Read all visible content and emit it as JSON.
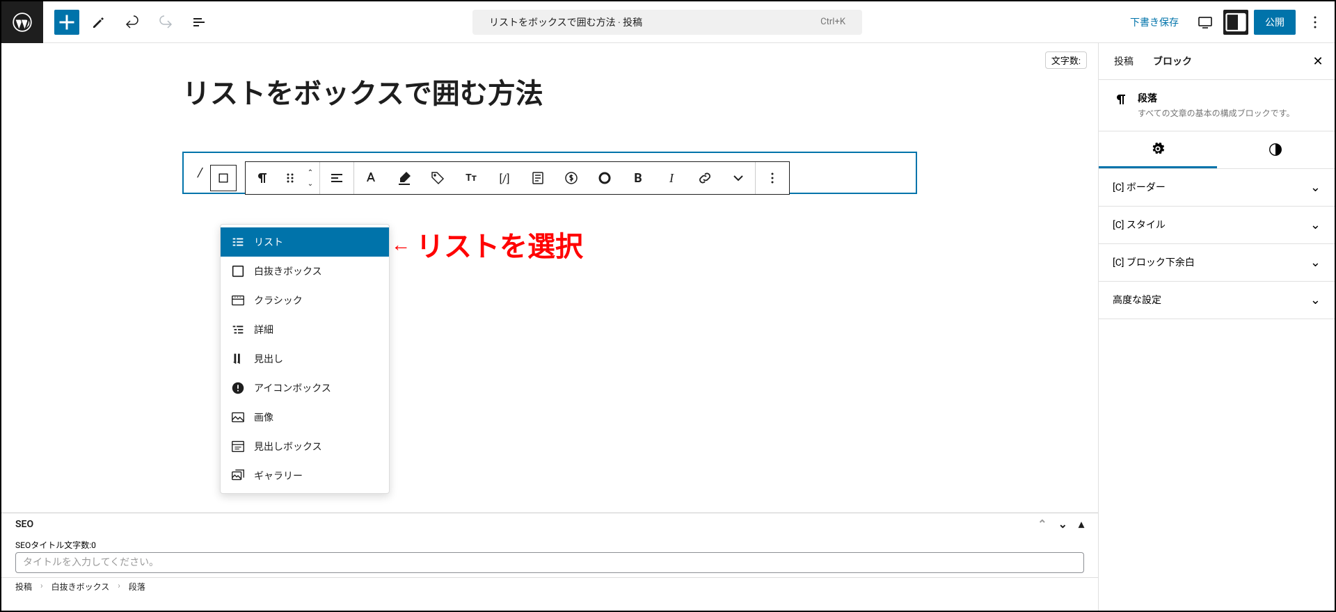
{
  "header": {
    "doc_title": "リストをボックスで囲む方法 · 投稿",
    "shortcut": "Ctrl+K",
    "save_draft": "下書き保存",
    "publish": "公開"
  },
  "editor": {
    "word_count_label": "文字数:",
    "post_title": "リストをボックスで囲む方法",
    "para_content": "/",
    "annotation": "リストを選択"
  },
  "dropdown": {
    "items": [
      {
        "label": "リスト",
        "icon": "list"
      },
      {
        "label": "白抜きボックス",
        "icon": "box"
      },
      {
        "label": "クラシック",
        "icon": "classic"
      },
      {
        "label": "詳細",
        "icon": "details"
      },
      {
        "label": "見出し",
        "icon": "heading"
      },
      {
        "label": "アイコンボックス",
        "icon": "iconbox"
      },
      {
        "label": "画像",
        "icon": "image"
      },
      {
        "label": "見出しボックス",
        "icon": "headingbox"
      },
      {
        "label": "ギャラリー",
        "icon": "gallery"
      }
    ]
  },
  "seo": {
    "title": "SEO",
    "title_count_label": "SEOタイトル文字数:0",
    "input_placeholder": "タイトルを入力してください。"
  },
  "breadcrumb": [
    "投稿",
    "白抜きボックス",
    "段落"
  ],
  "sidebar": {
    "tabs": [
      "投稿",
      "ブロック"
    ],
    "block_name": "段落",
    "block_desc": "すべての文章の基本の構成ブロックです。",
    "panels": [
      "[C] ボーダー",
      "[C] スタイル",
      "[C] ブロック下余白",
      "高度な設定"
    ]
  }
}
